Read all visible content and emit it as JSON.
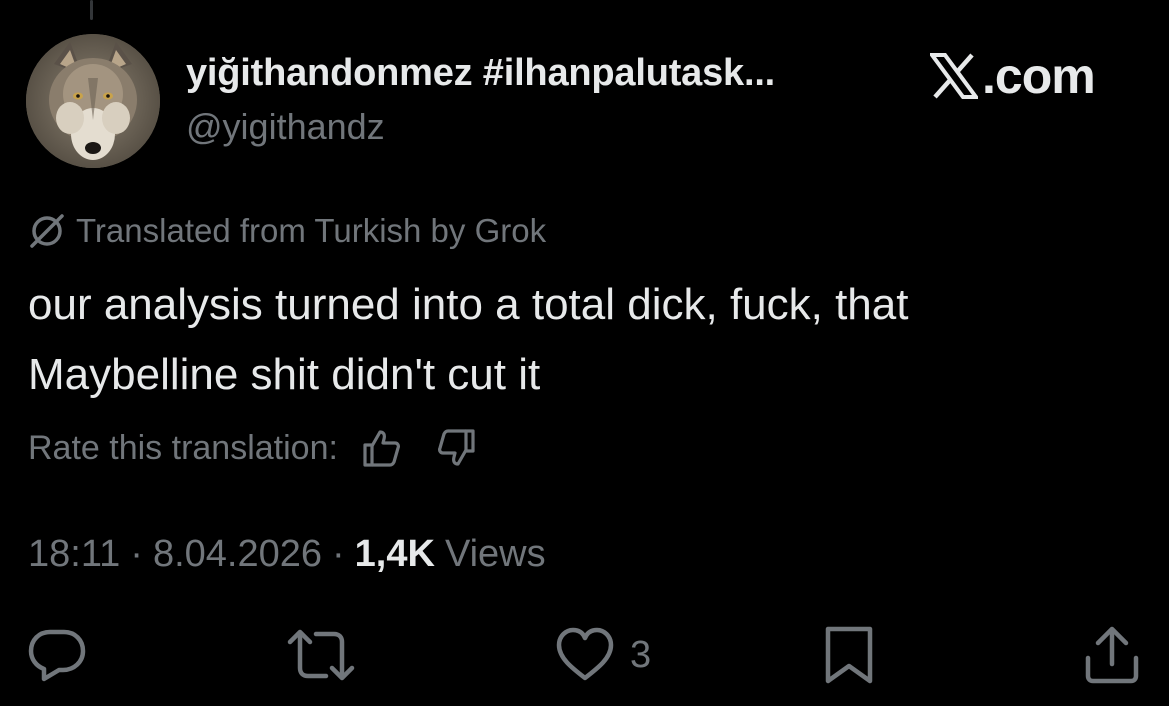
{
  "tweet": {
    "author": {
      "display_name": "yiğithandonmez #ilhanpalutask...",
      "handle": "@yigithandz",
      "avatar_icon": "wolf-avatar"
    },
    "brand": {
      "text": ".com",
      "icon": "x-logo-icon"
    },
    "translation_notice": {
      "icon": "grok-icon",
      "text": "Translated from Turkish by Grok"
    },
    "text_lines": [
      "our analysis turned into a total dick, fuck, that",
      "Maybelline shit didn't cut it"
    ],
    "rate": {
      "label": "Rate this translation:",
      "up_icon": "thumbs-up-icon",
      "down_icon": "thumbs-down-icon"
    },
    "meta": {
      "time": "18:11",
      "separator": "·",
      "date": "8.04.2026",
      "views_count": "1,4K",
      "views_label": "Views"
    },
    "actions": {
      "reply_icon": "reply-icon",
      "retweet_icon": "retweet-icon",
      "like_icon": "heart-icon",
      "like_count": "3",
      "bookmark_icon": "bookmark-icon",
      "share_icon": "share-icon"
    },
    "colors": {
      "background": "#000000",
      "primary_text": "#e7e9ea",
      "secondary_text": "#71767b"
    }
  }
}
